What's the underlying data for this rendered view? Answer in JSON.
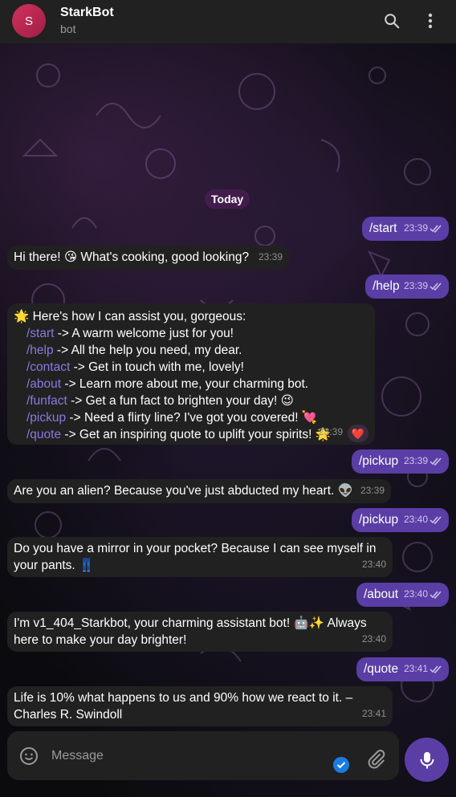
{
  "header": {
    "avatar_letter": "S",
    "title": "StarkBot",
    "subtitle": "bot"
  },
  "date_divider": "Today",
  "messages": [
    {
      "text": "/start",
      "time": "23:39"
    },
    {
      "text": "Hi there! 😘 What's cooking, good looking?",
      "time": "23:39"
    },
    {
      "text": "/help",
      "time": "23:39"
    },
    {
      "intro": "🌟 Here's how I can assist you, gorgeous:",
      "items": [
        {
          "cmd": "/start",
          "text": " -> A warm welcome just for you!"
        },
        {
          "cmd": "/help",
          "text": " -> All the help you need, my dear."
        },
        {
          "cmd": "/contact",
          "text": " -> Get in touch with me, lovely!"
        },
        {
          "cmd": "/about",
          "text": " -> Learn more about me, your charming bot."
        },
        {
          "cmd": "/funfact",
          "text": " -> Get a fun fact to brighten your day! 😉"
        },
        {
          "cmd": "/pickup",
          "text": " -> Need a flirty line? I've got you covered! 💘"
        },
        {
          "cmd": "/quote",
          "text": " -> Get an inspiring quote to uplift your spirits! 🌟"
        }
      ],
      "time": "23:39",
      "reaction": "❤️"
    },
    {
      "text": "/pickup",
      "time": "23:39"
    },
    {
      "text": "Are you an alien? Because you've just abducted my heart. 👽",
      "time": "23:39"
    },
    {
      "text": "/pickup",
      "time": "23:40"
    },
    {
      "line1": "Do you have a mirror in your pocket? Because I can see myself in",
      "line2": "your pants. 👖",
      "time": "23:40"
    },
    {
      "text": "/about",
      "time": "23:40"
    },
    {
      "line1": "I'm v1_404_Starkbot, your charming assistant bot! 🤖✨ Always",
      "line2": "here to make your day brighter!",
      "time": "23:40"
    },
    {
      "text": "/quote",
      "time": "23:41"
    },
    {
      "line1": "Life is 10% what happens to us and 90% how we react to it. –",
      "line2": "Charles R. Swindoll",
      "time": "23:41"
    }
  ],
  "input": {
    "placeholder": "Message"
  },
  "colors": {
    "outgoing": "#5a3ea5",
    "incoming": "#212121",
    "link": "#8d78e0",
    "header": "#212121"
  },
  "icons": [
    "search-icon",
    "more-vert-icon",
    "emoji-icon",
    "checkmark-badge-icon",
    "attach-icon",
    "mic-icon",
    "double-check-icon"
  ]
}
